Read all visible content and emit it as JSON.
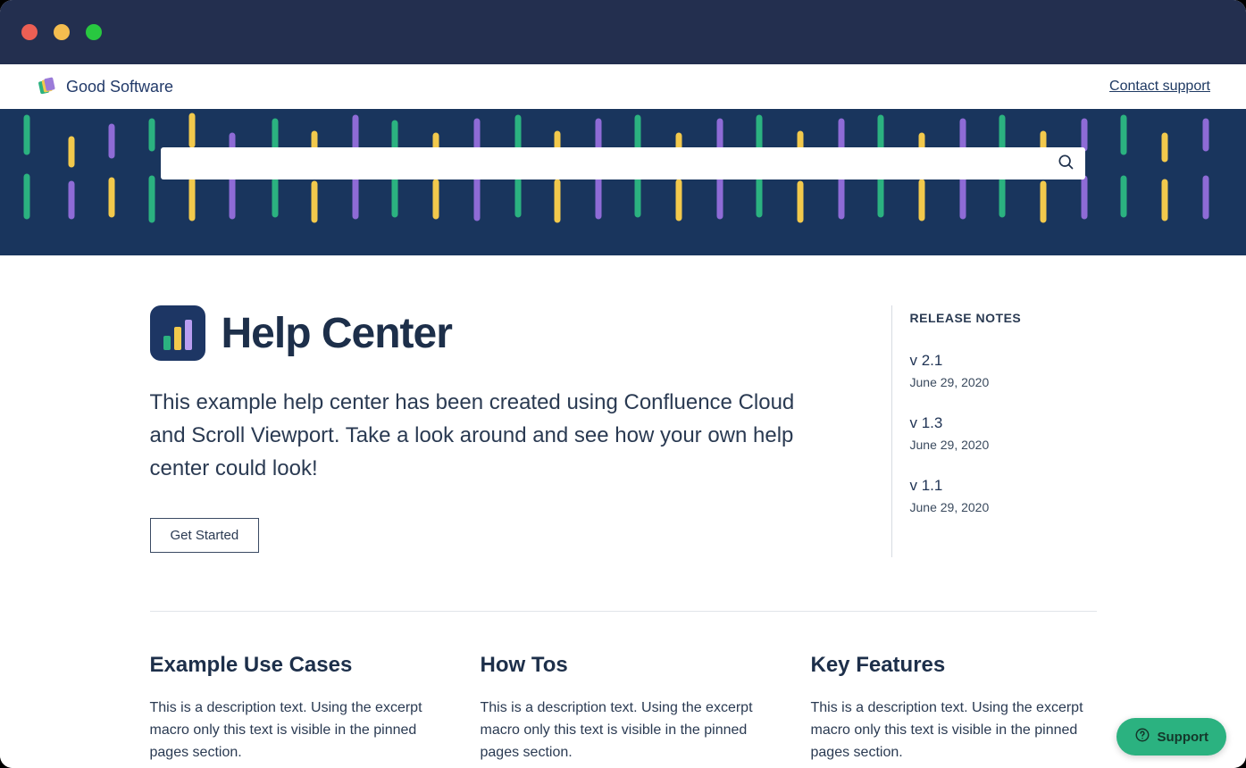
{
  "brand": {
    "name": "Good Software"
  },
  "nav": {
    "contact": "Contact support"
  },
  "search": {
    "placeholder": ""
  },
  "help_center": {
    "title": "Help Center",
    "description": "This example help center has been created using Confluence Cloud and Scroll Viewport. Take a look around and see how your own help center could look!",
    "cta": "Get Started"
  },
  "release_notes": {
    "heading": "RELEASE NOTES",
    "items": [
      {
        "version": "v 2.1",
        "date": "June 29, 2020"
      },
      {
        "version": "v 1.3",
        "date": "June 29, 2020"
      },
      {
        "version": "v 1.1",
        "date": "June 29, 2020"
      }
    ]
  },
  "cards": [
    {
      "title": "Example Use Cases",
      "desc": "This is a description text. Using the excerpt macro only this text is visible in the pinned pages section."
    },
    {
      "title": "How Tos",
      "desc": "This is a description text. Using the excerpt macro only this text is visible in the pinned pages section."
    },
    {
      "title": "Key Features",
      "desc": "This is a description text. Using the excerpt macro only this text is visible in the pinned pages section."
    }
  ],
  "support_widget": {
    "label": "Support"
  },
  "colors": {
    "titlebar": "#232f4f",
    "hero": "#19355d",
    "accent_green": "#2bb280",
    "accent_yellow": "#f2c94c",
    "accent_purple": "#8e6bd6"
  }
}
